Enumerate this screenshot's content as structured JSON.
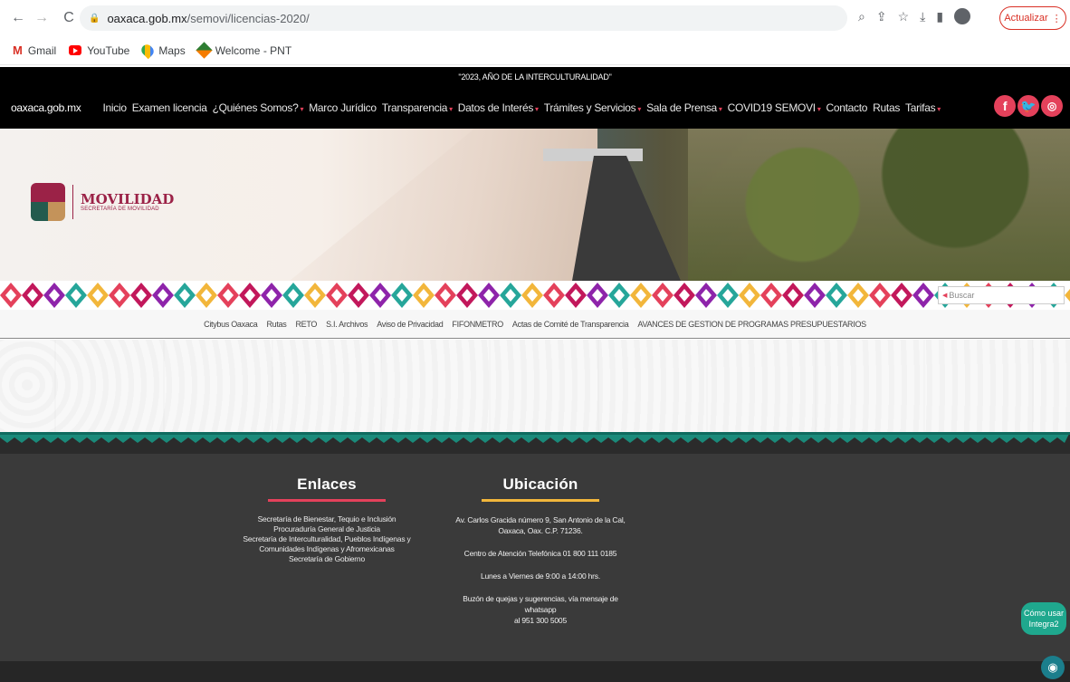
{
  "browser": {
    "url_host": "oaxaca.gob.mx",
    "url_path": "/semovi/licencias-2020/",
    "update_label": "Actualizar",
    "bookmarks": [
      {
        "label": "Gmail",
        "icon": "gmail-icon"
      },
      {
        "label": "YouTube",
        "icon": "youtube-icon"
      },
      {
        "label": "Maps",
        "icon": "maps-icon"
      },
      {
        "label": "Welcome - PNT",
        "icon": "pnt-icon"
      }
    ]
  },
  "site": {
    "announcement": "\"2023, AÑO DE LA INTERCULTURALIDAD\"",
    "home_link": "oaxaca.gob.mx",
    "nav": [
      {
        "label": "Inicio",
        "dropdown": false
      },
      {
        "label": "Examen licencia",
        "dropdown": false
      },
      {
        "label": "¿Quiénes Somos?",
        "dropdown": true
      },
      {
        "label": "Marco Jurídico",
        "dropdown": false
      },
      {
        "label": "Transparencia",
        "dropdown": true
      },
      {
        "label": "Datos de Interés",
        "dropdown": true
      },
      {
        "label": "Trámites y Servicios",
        "dropdown": true
      },
      {
        "label": "Sala de Prensa",
        "dropdown": true
      },
      {
        "label": "COVID19 SEMOVI",
        "dropdown": true
      },
      {
        "label": "Contacto",
        "dropdown": false
      },
      {
        "label": "Rutas",
        "dropdown": false
      },
      {
        "label": "Tarifas",
        "dropdown": true
      }
    ],
    "brand": {
      "title": "MOVILIDAD",
      "subtitle": "SECRETARÍA DE MOVILIDAD"
    },
    "search_placeholder": "Buscar",
    "subnav": [
      "Citybus Oaxaca",
      "Rutas",
      "RETO",
      "S.I. Archivos",
      "Aviso de Privacidad",
      "FIFONMETRO",
      "Actas de Comité de Transparencia",
      "AVANCES DE GESTION DE PROGRAMAS PRESUPUESTARIOS"
    ],
    "footer": {
      "enlaces_title": "Enlaces",
      "enlaces": [
        "Secretaría de Bienestar, Tequio e Inclusión",
        "Procuraduría General de Justicia",
        "Secretaría de Interculturalidad, Pueblos Indígenas y",
        "Comunidades Indígenas y Afromexicanas",
        "Secretaría de Gobierno"
      ],
      "ubicacion_title": "Ubicación",
      "address_line1": "Av. Carlos Gracida número 9, San Antonio de la Cal,",
      "address_line2": "Oaxaca, Oax. C.P. 71236.",
      "phone": "Centro de Atención Telefónica 01 800 111 0185",
      "hours": "Lunes a Viernes de 9:00 a 14:00 hrs.",
      "complaints_line1": "Buzón de quejas y sugerencias, vía mensaje de whatsapp",
      "complaints_line2": "al 951 300 5005"
    },
    "help_line1": "Cómo usar",
    "help_line2": "Integra2"
  },
  "colors": {
    "accent_pink": "#e4415b",
    "accent_yellow": "#f2b63b",
    "brand_wine": "#9b2247",
    "help_teal": "#1fa88e"
  }
}
